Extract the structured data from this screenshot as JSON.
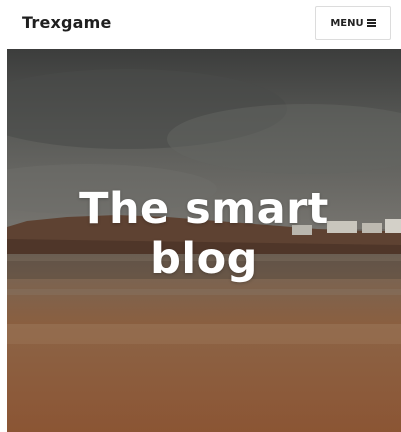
{
  "header": {
    "site_title": "Trexgame",
    "menu_label": "MENU"
  },
  "hero": {
    "title_line1": "The smart",
    "title_line2": "blog"
  },
  "colors": {
    "sky_top": "#3f403f",
    "sky_bottom": "#6f6d6a",
    "headland": "#5a3b2b",
    "sand": "#8a5a3c",
    "text_white": "#ffffff"
  },
  "icons": {
    "menu": "hamburger-icon"
  }
}
